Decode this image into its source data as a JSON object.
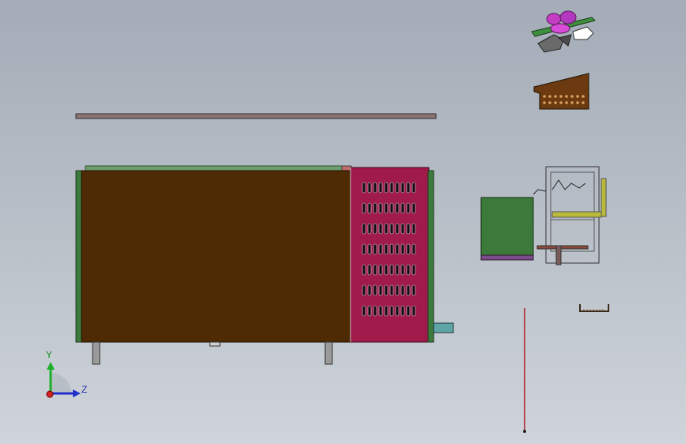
{
  "app": {
    "title": ""
  },
  "viewport": {
    "background_top": "#a3acb7",
    "background_bottom": "#cfd4da"
  },
  "triad": {
    "y_label": "Y",
    "z_label": "Z",
    "colors": {
      "y": "#1fae2a",
      "z": "#2233cc",
      "x": "#d42020"
    }
  },
  "colors": {
    "body_brown": "#4e2a05",
    "panel_magenta": "#a01a4a",
    "green_trim": "#3d7a3d",
    "top_rail": "#8a7575",
    "unit_green": "#3b7a3b",
    "unit_purple": "#7a4a8a",
    "pipe_yellow": "#b9b93a",
    "stand_teal": "#5ea6a6"
  },
  "icons": [
    "triad-icon",
    "vent-slot-icon",
    "fan-assembly-icon",
    "bracket-icon"
  ]
}
